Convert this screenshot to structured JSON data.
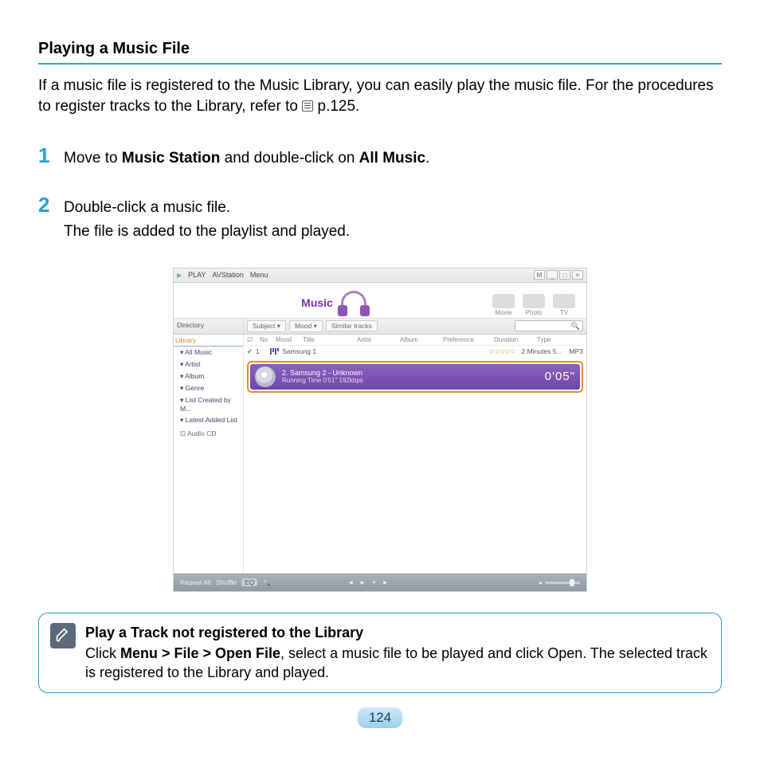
{
  "page_number": "124",
  "heading": "Playing a Music File",
  "intro_pre": "If a music file is registered to the Music Library, you can easily play the music file. For the procedures to register tracks to the Library, refer to ",
  "intro_ref": " p.125.",
  "steps": [
    {
      "num": "1",
      "line1_a": "Move to ",
      "line1_b_bold": "Music Station",
      "line1_c": " and double-click on ",
      "line1_d_bold": "All Music",
      "line1_e": "."
    },
    {
      "num": "2",
      "line1": "Double-click a music file.",
      "line2": "The file is added to the playlist and played."
    }
  ],
  "app": {
    "titlebar": {
      "play": "PLAY",
      "avstation": "AVStation",
      "menu": "Menu"
    },
    "win_btns": {
      "mode": "M",
      "min": "_",
      "max": "□",
      "close": "×"
    },
    "brand": "Music",
    "mode_tabs": [
      "Movie",
      "Photo",
      "TV"
    ],
    "directory_label": "Directory",
    "filters": {
      "subject": "Subject ▾",
      "mood": "Mood ▾",
      "similar": "Similar tracks"
    },
    "sidebar": {
      "library": "Library",
      "items": [
        "All Music",
        "Artist",
        "Album",
        "Genre",
        "List Created by M...",
        "Latest Added List"
      ],
      "audio_cd": "Audio CD"
    },
    "columns": [
      "☑",
      "No",
      "Mood",
      "Title",
      "Artist",
      "Album",
      "Preference",
      "Duration",
      "Type"
    ],
    "track1": {
      "no": "1",
      "title": "Samsung 1",
      "stars": "☆☆☆☆☆",
      "duration": "2 Minutes 5...",
      "type": "MP3"
    },
    "nowplaying": {
      "title": "2. Samsung 2 - Unknown",
      "sub": "Running Time 0'51\"   192kbps",
      "time": "0'05\""
    },
    "playbar": {
      "repeat": "Repeat All",
      "shuffle": "Shuffle",
      "eq": "EQ"
    }
  },
  "note": {
    "title": "Play a Track not registered to the Library",
    "body_a": "Click ",
    "body_b_bold": "Menu > File > Open File",
    "body_c": ", select a music file to be played and click Open. The selected track is registered to the Library and played."
  }
}
